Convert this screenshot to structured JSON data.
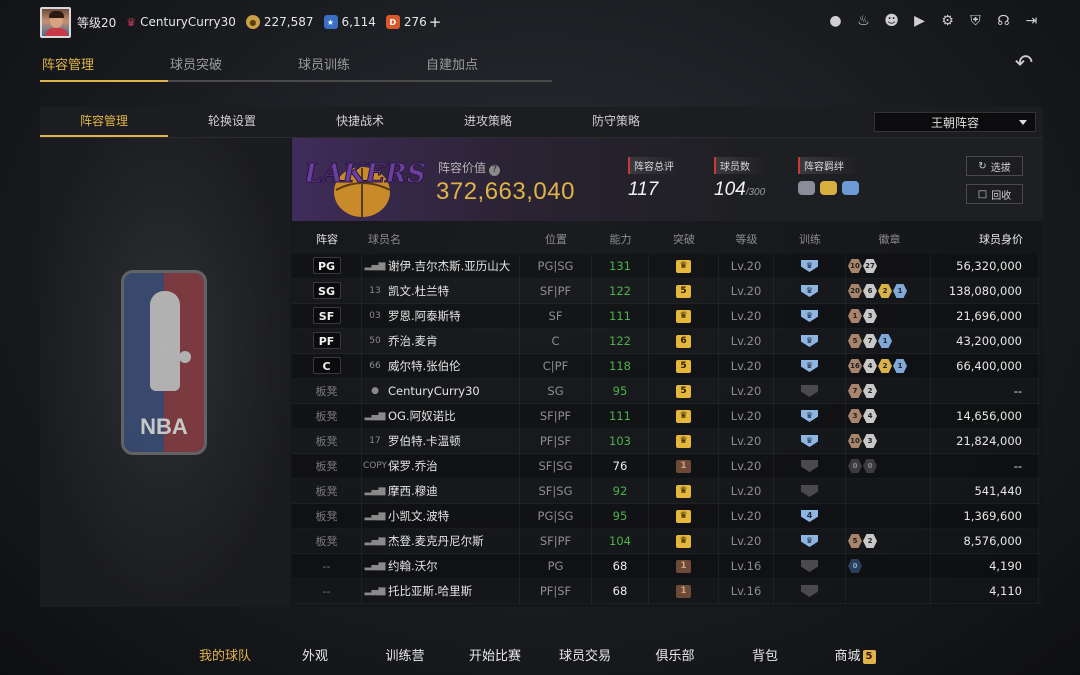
{
  "user": {
    "level": "等级20",
    "name": "CenturyCurry30",
    "coins": "227,587",
    "points": "6,114",
    "tickets": "276",
    "add": "+"
  },
  "main_tabs": [
    {
      "label": "阵容管理",
      "active": true
    },
    {
      "label": "球员突破",
      "active": false
    },
    {
      "label": "球员训练",
      "active": false
    },
    {
      "label": "自建加点",
      "active": false
    }
  ],
  "sub_tabs": [
    {
      "label": "阵容管理",
      "active": true
    },
    {
      "label": "轮换设置",
      "active": false
    },
    {
      "label": "快捷战术",
      "active": false
    },
    {
      "label": "进攻策略",
      "active": false
    },
    {
      "label": "防守策略",
      "active": false
    }
  ],
  "lineup_select": "王朝阵容",
  "banner": {
    "value_label": "阵容价值",
    "value": "372,663,040",
    "rating_label": "阵容总评",
    "rating": "117",
    "count_label": "球员数",
    "count": "104",
    "count_max": "/300",
    "bond_label": "阵容羁绊",
    "select_btn": "选拔",
    "recycle_btn": "回收"
  },
  "columns": [
    "阵容",
    "球员名",
    "位置",
    "能力",
    "突破",
    "等级",
    "训练",
    "徽章",
    "球员身价"
  ],
  "rows": [
    {
      "slot": "PG",
      "starter": true,
      "icon": "signal",
      "name": "谢伊.吉尔杰斯.亚历山大",
      "pos": "PG|SG",
      "ovr": "131",
      "ovr_color": "green",
      "brk": "crown",
      "brk_type": "gold",
      "lv": "Lv.20",
      "trn": "crown",
      "trn_type": "blue",
      "badges": [
        [
          "bronze",
          "10"
        ],
        [
          "silver",
          "27"
        ]
      ],
      "price": "56,320,000"
    },
    {
      "slot": "SG",
      "starter": true,
      "icon": "13",
      "name": "凯文.杜兰特",
      "pos": "SF|PF",
      "ovr": "122",
      "ovr_color": "green",
      "brk": "5",
      "brk_type": "gold",
      "lv": "Lv.20",
      "trn": "crown",
      "trn_type": "blue",
      "badges": [
        [
          "bronze",
          "20"
        ],
        [
          "silver",
          "6"
        ],
        [
          "gold",
          "2"
        ],
        [
          "hof",
          "1"
        ]
      ],
      "price": "138,080,000"
    },
    {
      "slot": "SF",
      "starter": true,
      "icon": "03",
      "name": "罗恩.阿泰斯特",
      "pos": "SF",
      "ovr": "111",
      "ovr_color": "green",
      "brk": "crown",
      "brk_type": "gold",
      "lv": "Lv.20",
      "trn": "crown",
      "trn_type": "blue",
      "badges": [
        [
          "bronze",
          "1"
        ],
        [
          "silver",
          "3"
        ]
      ],
      "price": "21,696,000"
    },
    {
      "slot": "PF",
      "starter": true,
      "icon": "50",
      "name": "乔治.麦肯",
      "pos": "C",
      "ovr": "122",
      "ovr_color": "green",
      "brk": "6",
      "brk_type": "gold",
      "lv": "Lv.20",
      "trn": "crown",
      "trn_type": "blue",
      "badges": [
        [
          "bronze",
          "5"
        ],
        [
          "silver",
          "7"
        ],
        [
          "hof",
          "1"
        ]
      ],
      "price": "43,200,000"
    },
    {
      "slot": "C",
      "starter": true,
      "icon": "66",
      "name": "威尔特.张伯伦",
      "pos": "C|PF",
      "ovr": "118",
      "ovr_color": "green",
      "brk": "5",
      "brk_type": "gold",
      "lv": "Lv.20",
      "trn": "crown",
      "trn_type": "blue",
      "badges": [
        [
          "bronze",
          "16"
        ],
        [
          "silver",
          "4"
        ],
        [
          "gold",
          "2"
        ],
        [
          "hof",
          "1"
        ]
      ],
      "price": "66,400,000"
    },
    {
      "slot": "板凳",
      "starter": false,
      "icon": "person",
      "name": "CenturyCurry30",
      "pos": "SG",
      "ovr": "95",
      "ovr_color": "green",
      "brk": "5",
      "brk_type": "gold",
      "lv": "Lv.20",
      "trn": "",
      "trn_type": "dim",
      "badges": [
        [
          "bronze",
          "7"
        ],
        [
          "silver",
          "2"
        ]
      ],
      "price": "--"
    },
    {
      "slot": "板凳",
      "starter": false,
      "icon": "signal",
      "name": "OG.阿奴诺比",
      "pos": "SF|PF",
      "ovr": "111",
      "ovr_color": "green",
      "brk": "crown",
      "brk_type": "gold",
      "lv": "Lv.20",
      "trn": "crown",
      "trn_type": "blue",
      "badges": [
        [
          "bronze",
          "3"
        ],
        [
          "silver",
          "4"
        ]
      ],
      "price": "14,656,000"
    },
    {
      "slot": "板凳",
      "starter": false,
      "icon": "17",
      "name": "罗伯特.卡温顿",
      "pos": "PF|SF",
      "ovr": "103",
      "ovr_color": "green",
      "brk": "crown",
      "brk_type": "gold",
      "lv": "Lv.20",
      "trn": "crown",
      "trn_type": "blue",
      "badges": [
        [
          "bronze",
          "10"
        ],
        [
          "silver",
          "3"
        ]
      ],
      "price": "21,824,000"
    },
    {
      "slot": "板凳",
      "starter": false,
      "icon": "COPY",
      "name": "保罗.乔治",
      "pos": "SF|SG",
      "ovr": "76",
      "ovr_color": "white",
      "brk": "1",
      "brk_type": "brown",
      "lv": "Lv.20",
      "trn": "",
      "trn_type": "dim",
      "badges": [
        [
          "dark",
          "0"
        ],
        [
          "dark",
          "0"
        ]
      ],
      "price": "--"
    },
    {
      "slot": "板凳",
      "starter": false,
      "icon": "signal",
      "name": "摩西.穆迪",
      "pos": "SF|SG",
      "ovr": "92",
      "ovr_color": "green",
      "brk": "crown",
      "brk_type": "gold",
      "lv": "Lv.20",
      "trn": "",
      "trn_type": "dim",
      "badges": [],
      "price": "541,440"
    },
    {
      "slot": "板凳",
      "starter": false,
      "icon": "signal",
      "name": "小凯文.波特",
      "pos": "PG|SG",
      "ovr": "95",
      "ovr_color": "green",
      "brk": "crown",
      "brk_type": "gold",
      "lv": "Lv.20",
      "trn": "4",
      "trn_type": "blue",
      "badges": [],
      "price": "1,369,600"
    },
    {
      "slot": "板凳",
      "starter": false,
      "icon": "signal",
      "name": "杰登.麦克丹尼尔斯",
      "pos": "SF|PF",
      "ovr": "104",
      "ovr_color": "green",
      "brk": "crown",
      "brk_type": "gold",
      "lv": "Lv.20",
      "trn": "crown",
      "trn_type": "blue",
      "badges": [
        [
          "bronze",
          "5"
        ],
        [
          "silver",
          "2"
        ]
      ],
      "price": "8,576,000"
    },
    {
      "slot": "--",
      "starter": false,
      "icon": "signal",
      "name": "约翰.沃尔",
      "pos": "PG",
      "ovr": "68",
      "ovr_color": "white",
      "brk": "1",
      "brk_type": "brown",
      "lv": "Lv.16",
      "trn": "",
      "trn_type": "dim",
      "badges": [
        [
          "darkblue",
          "0"
        ]
      ],
      "price": "4,190"
    },
    {
      "slot": "--",
      "starter": false,
      "icon": "signal",
      "name": "托比亚斯.哈里斯",
      "pos": "PF|SF",
      "ovr": "68",
      "ovr_color": "white",
      "brk": "1",
      "brk_type": "brown",
      "lv": "Lv.16",
      "trn": "",
      "trn_type": "dim",
      "badges": [],
      "price": "4,110"
    }
  ],
  "bottom_nav": [
    {
      "label": "我的球队",
      "active": true
    },
    {
      "label": "外观",
      "active": false
    },
    {
      "label": "训练营",
      "active": false
    },
    {
      "label": "开始比赛",
      "active": false
    },
    {
      "label": "球员交易",
      "active": false
    },
    {
      "label": "俱乐部",
      "active": false
    },
    {
      "label": "背包",
      "active": false
    },
    {
      "label": "商城",
      "active": false,
      "badge": "5"
    }
  ],
  "logo_text": "NBA",
  "team_logo_text": "LAKERS"
}
